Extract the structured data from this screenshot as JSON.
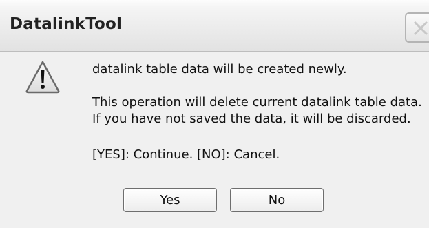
{
  "window": {
    "title": "DatalinkTool",
    "close_icon": "close-icon"
  },
  "message": {
    "icon": "warning-icon",
    "line1": "datalink table data will be created newly.",
    "line2": "This operation will delete current datalink table data.",
    "line3": "If you have not saved the data, it will be discarded.",
    "line4": "[YES]: Continue. [NO]: Cancel."
  },
  "buttons": {
    "yes_label": "Yes",
    "no_label": "No"
  }
}
